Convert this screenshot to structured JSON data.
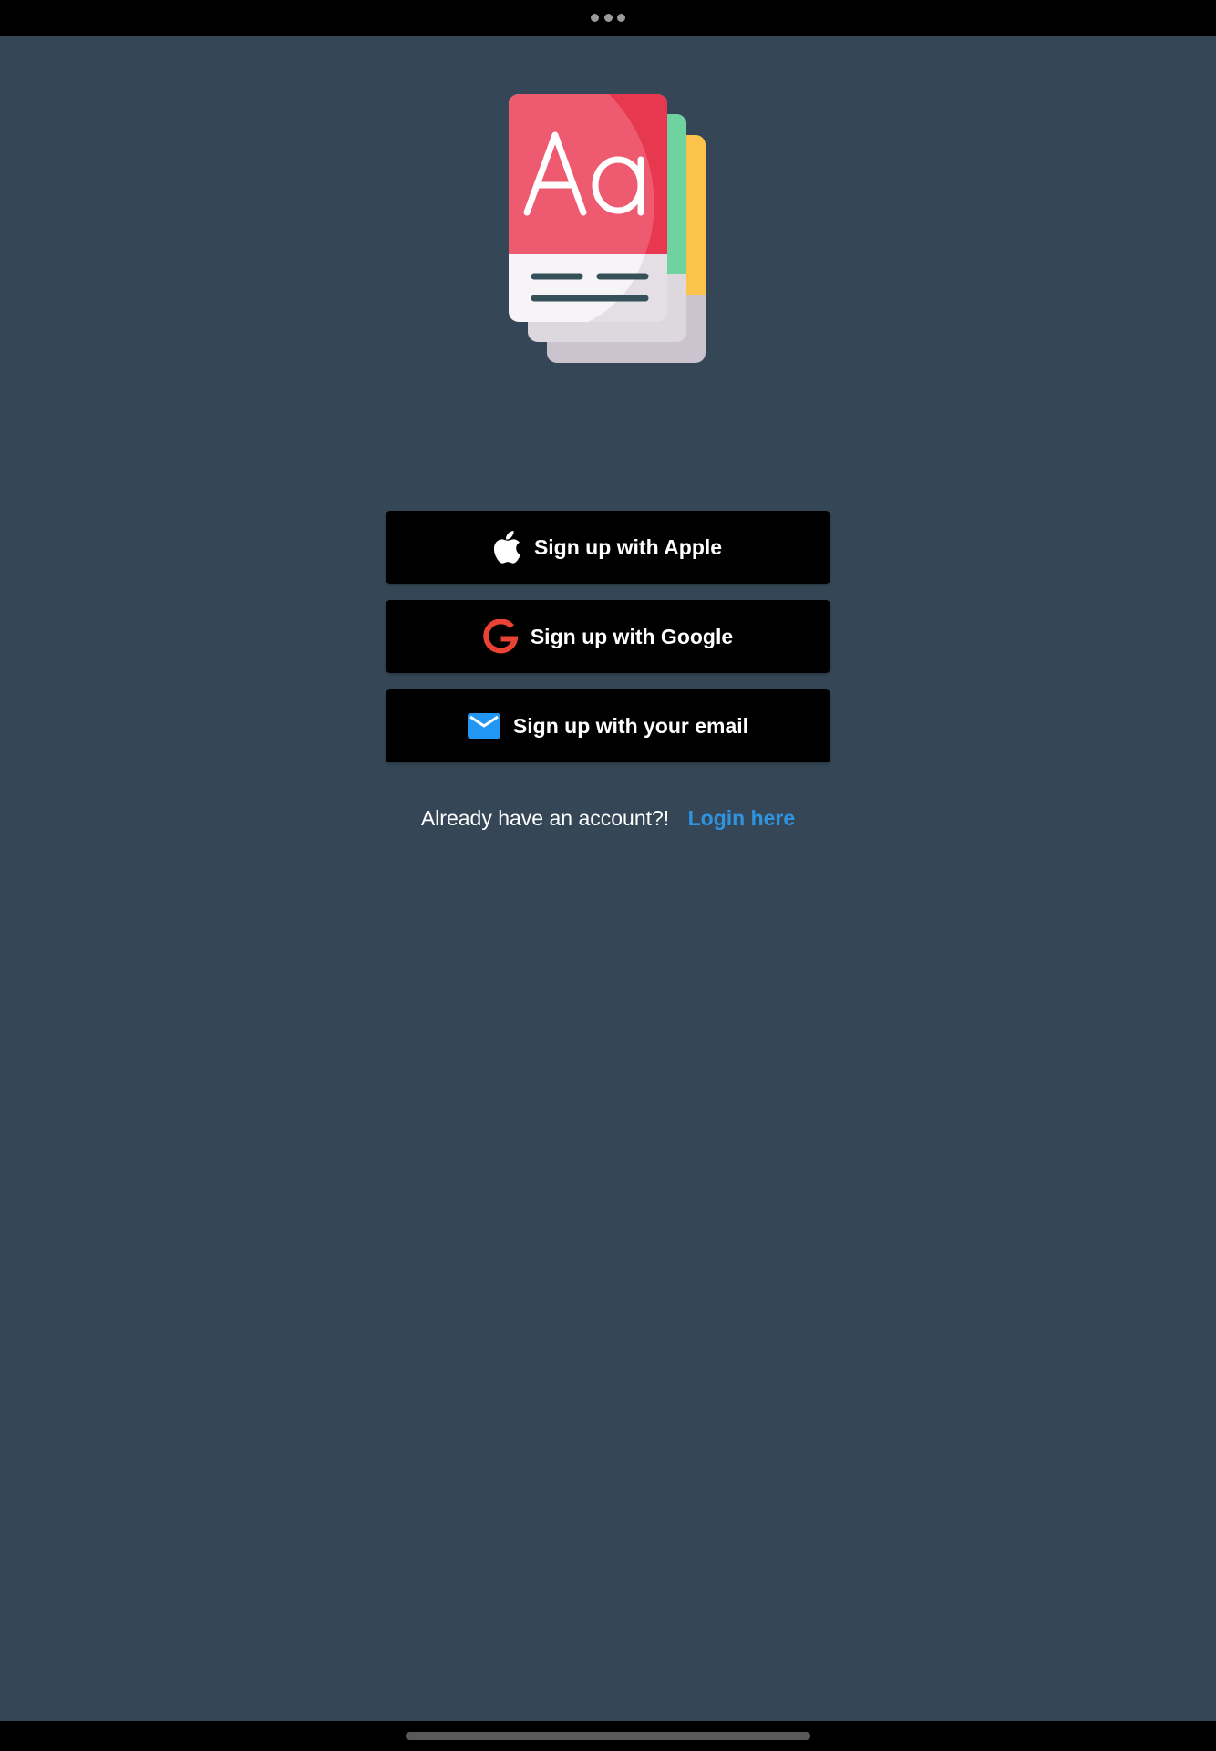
{
  "app": {
    "logo_icon": "dictionary-book-stack-icon"
  },
  "signup": {
    "apple": {
      "label": "Sign up with Apple",
      "icon": "apple-logo-icon"
    },
    "google": {
      "label": "Sign up with Google",
      "icon": "google-logo-icon"
    },
    "email": {
      "label": "Sign up with your email",
      "icon": "envelope-icon"
    }
  },
  "login": {
    "prompt": "Already have an account?!",
    "link_label": "Login here"
  },
  "colors": {
    "background": "#354756",
    "button_background": "#000000",
    "link": "#2f93e0",
    "google_red": "#ea4335",
    "email_blue": "#2196f3"
  }
}
